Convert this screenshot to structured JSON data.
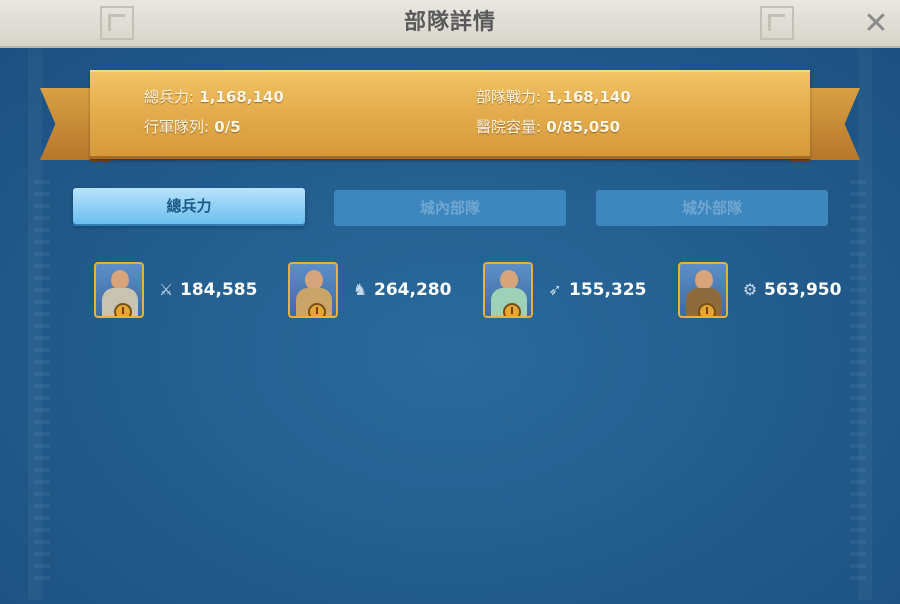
{
  "header": {
    "title": "部隊詳情"
  },
  "summary": {
    "total_troops_label": "總兵力:",
    "total_troops_value": "1,168,140",
    "troop_power_label": "部隊戰力:",
    "troop_power_value": "1,168,140",
    "march_queue_label": "行軍隊列:",
    "march_queue_value": "0/5",
    "hospital_label": "醫院容量:",
    "hospital_value": "0/85,050"
  },
  "tabs": [
    {
      "label": "總兵力",
      "active": true
    },
    {
      "label": "城內部隊",
      "active": false
    },
    {
      "label": "城外部隊",
      "active": false
    }
  ],
  "units": [
    {
      "type_icon": "sword-icon",
      "tier": "I",
      "count": "184,585"
    },
    {
      "type_icon": "horse-icon",
      "tier": "I",
      "count": "264,280"
    },
    {
      "type_icon": "bow-icon",
      "tier": "I",
      "count": "155,325"
    },
    {
      "type_icon": "siege-icon",
      "tier": "I",
      "count": "563,950"
    }
  ],
  "colors": {
    "background": "#1f5685",
    "ribbon": "#e4ad4d",
    "active_tab": "#8fd2f6",
    "inactive_tab": "#3e86be"
  }
}
